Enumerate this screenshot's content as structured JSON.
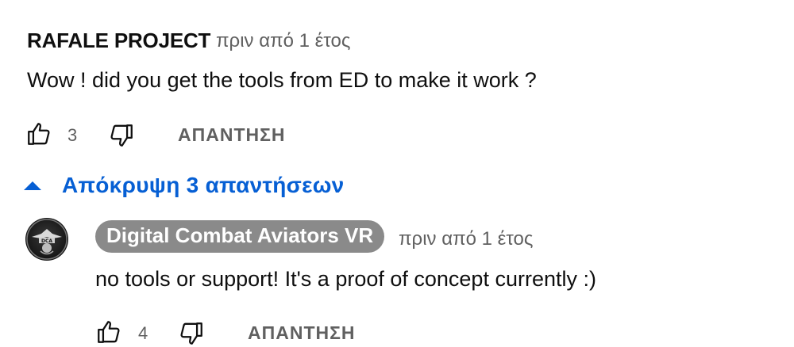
{
  "comment": {
    "author": "RAFALE PROJECT",
    "time": "πριν από 1 έτος",
    "text": "Wow !  did you get the tools from ED to make it work ?",
    "likes": "3",
    "reply_label": "ΑΠΑΝΤΗΣΗ"
  },
  "replies_toggle": {
    "label": "Απόκρυψη 3 απαντήσεων",
    "icon": "caret-up-icon",
    "color": "#065fd4"
  },
  "reply": {
    "author": "Digital Combat Aviators VR",
    "time": "πριν από 1 έτος",
    "text": "no tools or support! It's a proof of concept currently :)",
    "likes": "4",
    "reply_label": "ΑΠΑΝΤΗΣΗ",
    "avatar_icon": "channel-logo-icon"
  }
}
